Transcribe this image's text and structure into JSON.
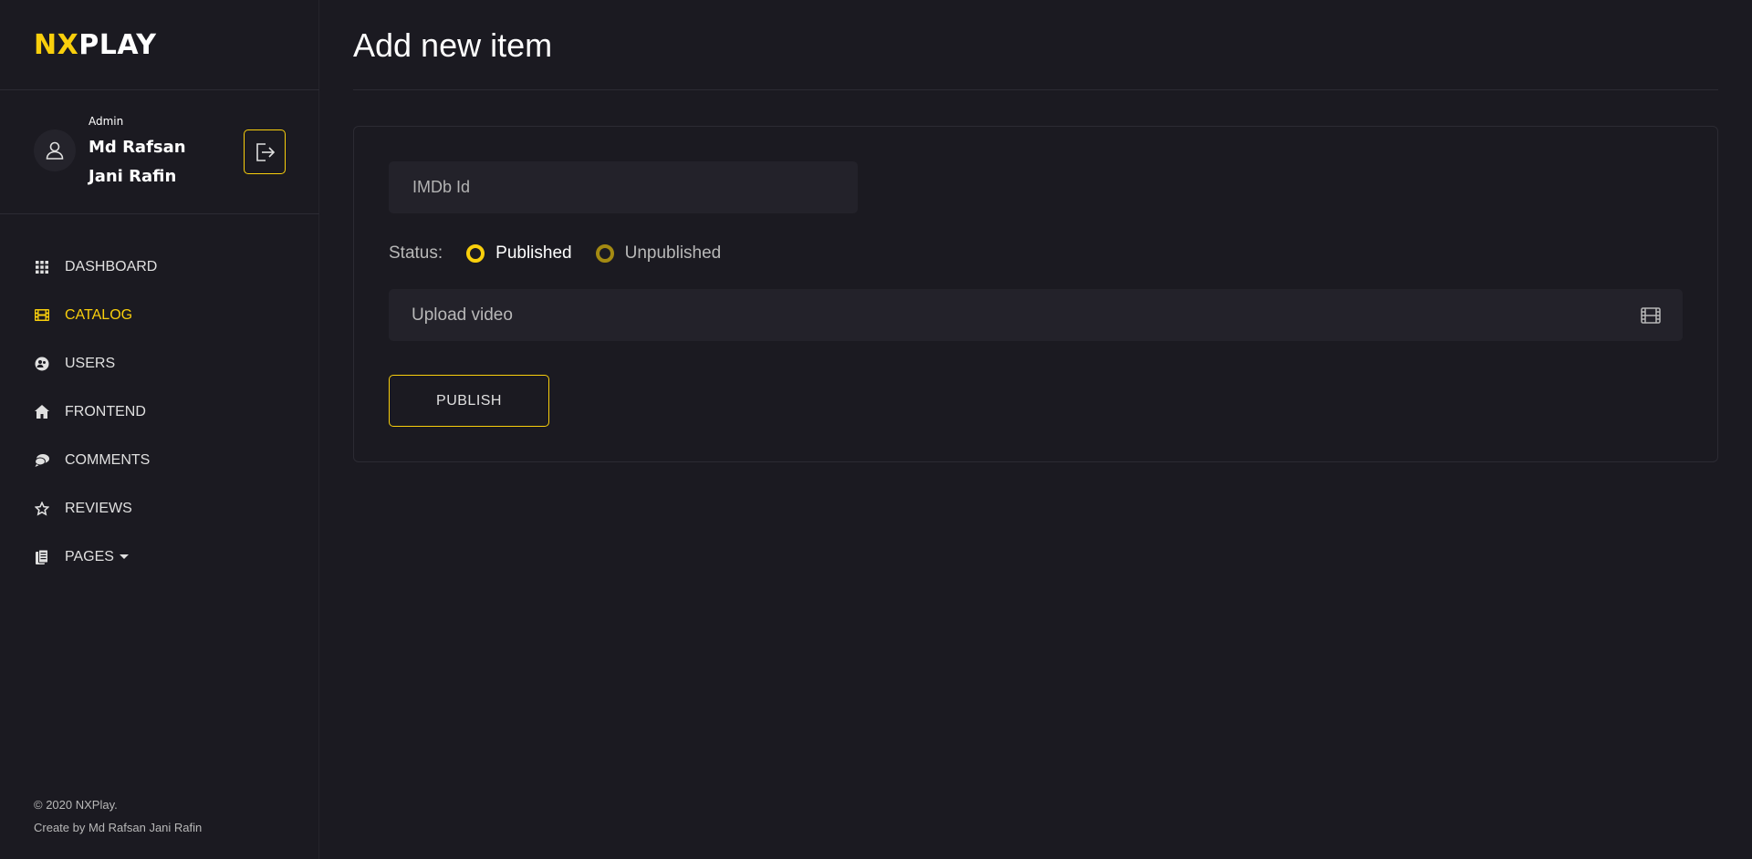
{
  "brand": {
    "accent_part": "NX",
    "rest_part": "PLAY",
    "accent_color": "#f9cf0c"
  },
  "user": {
    "role": "Admin",
    "name": "Md Rafsan Jani Rafin"
  },
  "nav": {
    "items": [
      {
        "label": "DASHBOARD",
        "icon": "grid-icon"
      },
      {
        "label": "CATALOG",
        "icon": "film-icon",
        "active": true
      },
      {
        "label": "USERS",
        "icon": "users-icon"
      },
      {
        "label": "FRONTEND",
        "icon": "home-icon"
      },
      {
        "label": "COMMENTS",
        "icon": "comments-icon"
      },
      {
        "label": "REVIEWS",
        "icon": "star-icon"
      },
      {
        "label": "PAGES",
        "icon": "pages-icon",
        "has_dropdown": true
      }
    ]
  },
  "footer": {
    "copyright": "© 2020 NXPlay.",
    "credit": "Create by Md Rafsan Jani Rafin"
  },
  "main": {
    "title": "Add new item",
    "form": {
      "imdb_placeholder": "IMDb Id",
      "status_label": "Status:",
      "status_options": [
        {
          "label": "Published",
          "selected": true
        },
        {
          "label": "Unpublished",
          "selected": false
        }
      ],
      "upload_label": "Upload video",
      "publish_label": "PUBLISH"
    }
  }
}
